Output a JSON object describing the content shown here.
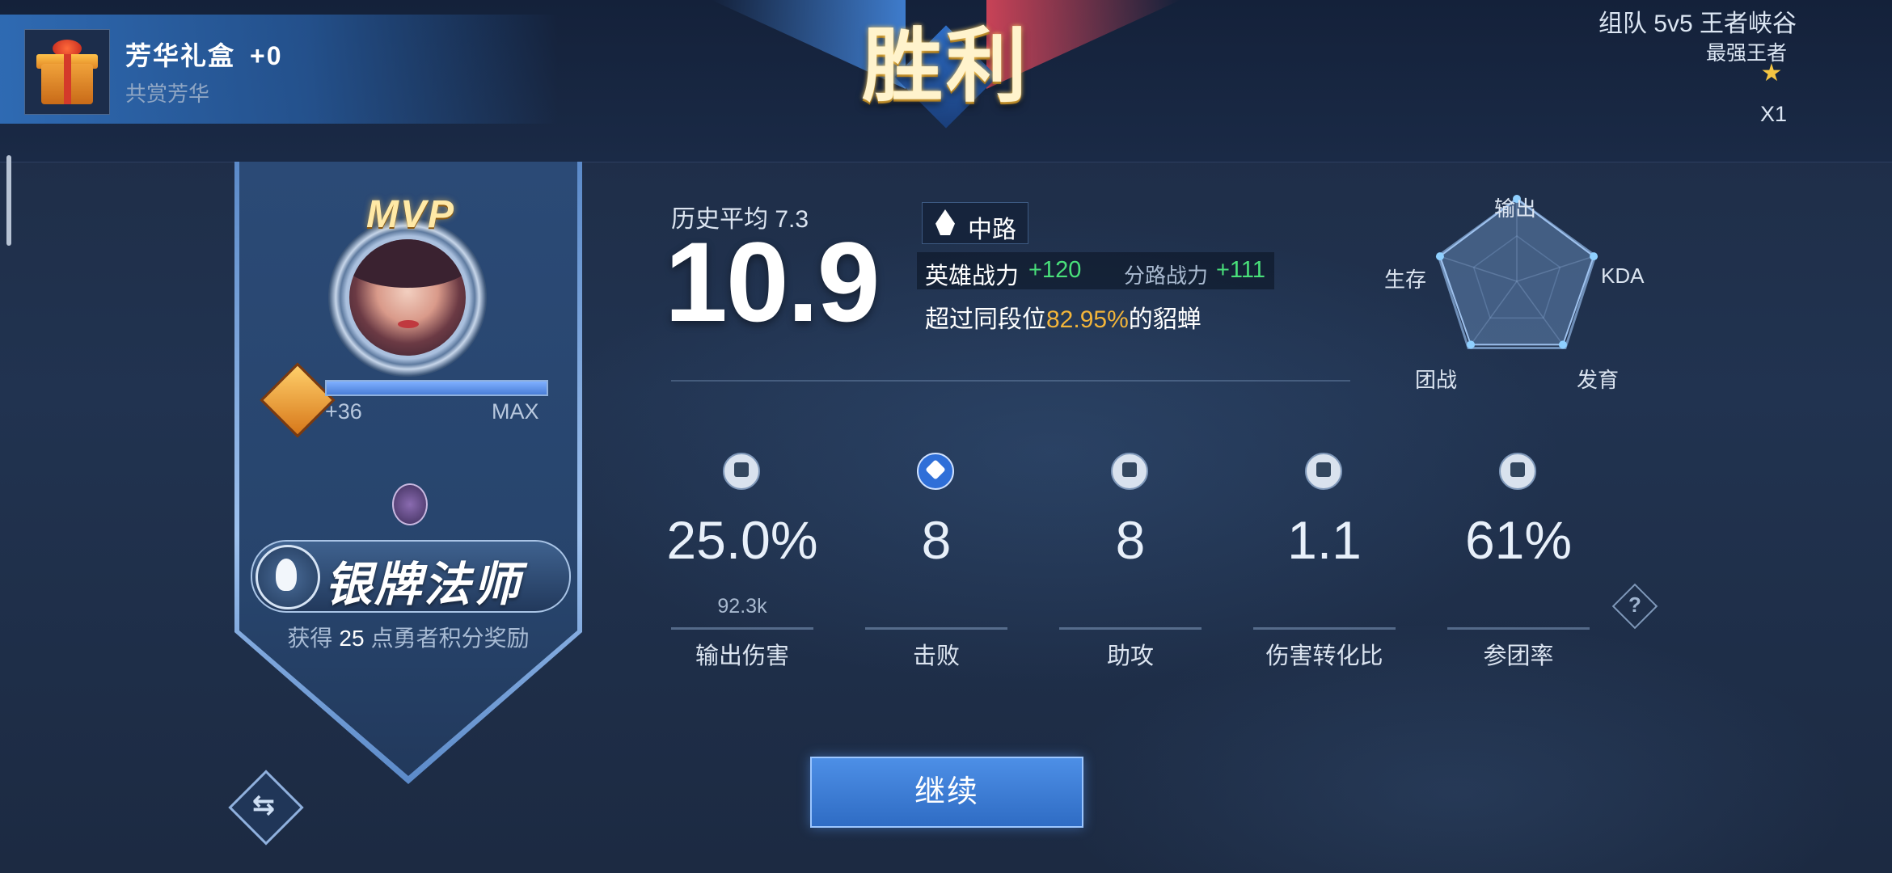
{
  "header": {
    "gift": {
      "title": "芳华礼盒",
      "bonus": "+0",
      "subtitle": "共赏芳华"
    },
    "result_title": "胜利",
    "mode": "组队 5v5 王者峡谷",
    "rank_name": "最强王者",
    "star_count": "X1"
  },
  "player": {
    "badge": "MVP",
    "progress": {
      "plus": "+36",
      "max_label": "MAX",
      "fill_fraction": 1.0
    },
    "rank_title": "银牌法师",
    "reward": {
      "prefix": "获得",
      "points": "25",
      "suffix": "点勇者积分奖励"
    }
  },
  "score": {
    "history_label": "历史平均 7.3",
    "value": "10.9",
    "lane": "中路",
    "hero_power_label": "英雄战力",
    "hero_power_value": "+120",
    "lane_power_label": "分路战力",
    "lane_power_value": "+111",
    "surpass_prefix": "超过同段位",
    "surpass_pct": "82.95%",
    "surpass_suffix": "的貂蝉"
  },
  "radar": {
    "labels": [
      "输出",
      "KDA",
      "发育",
      "团战",
      "生存"
    ],
    "values": [
      1.0,
      0.98,
      0.95,
      0.95,
      0.98
    ]
  },
  "stats": [
    {
      "label": "输出伤害",
      "value": "25.0%",
      "sub": "92.3k",
      "icon": "damage-icon"
    },
    {
      "label": "击败",
      "value": "8",
      "sub": "",
      "icon": "sword-icon"
    },
    {
      "label": "助攻",
      "value": "8",
      "sub": "",
      "icon": "fist-icon"
    },
    {
      "label": "伤害转化比",
      "value": "1.1",
      "sub": "",
      "icon": "gold-icon"
    },
    {
      "label": "参团率",
      "value": "61%",
      "sub": "",
      "icon": "flag-icon"
    }
  ],
  "actions": {
    "continue": "继续"
  }
}
